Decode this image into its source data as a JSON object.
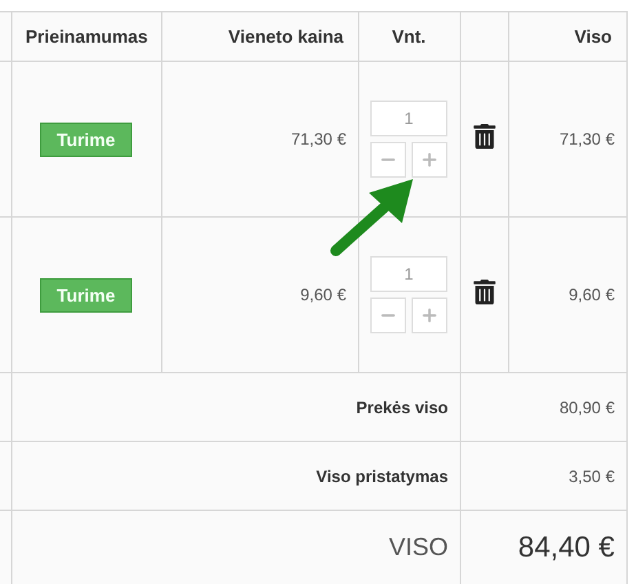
{
  "table": {
    "columns": [
      "",
      "Prieinamumas",
      "Vieneto kaina",
      "Vnt.",
      "",
      "Viso"
    ],
    "rows": [
      {
        "availability": "Turime",
        "unit_price": "71,30 €",
        "quantity": "1",
        "total": "71,30 €"
      },
      {
        "availability": "Turime",
        "unit_price": "9,60 €",
        "quantity": "1",
        "total": "9,60 €"
      }
    ],
    "summary": [
      {
        "kind": "subtotal",
        "label": "Prekės viso",
        "value": "80,90 €"
      },
      {
        "kind": "subtotal",
        "label": "Viso pristatymas",
        "value": "3,50 €"
      },
      {
        "kind": "grand",
        "label": "VISO",
        "value": "84,40 €"
      }
    ]
  }
}
